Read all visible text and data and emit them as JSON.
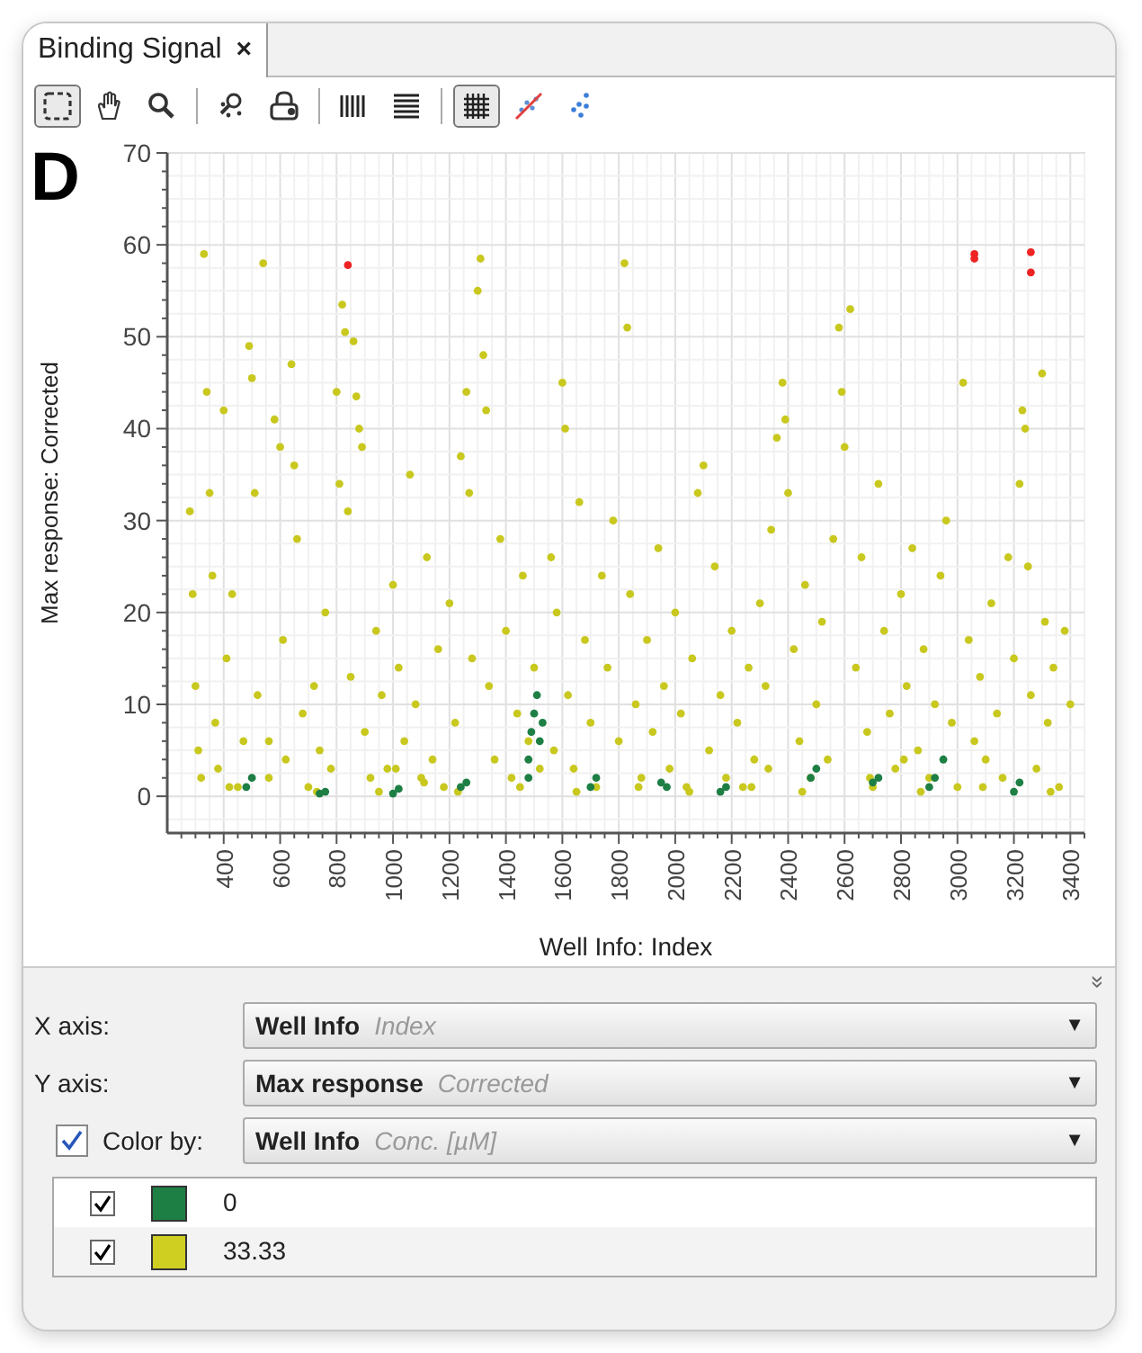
{
  "tabs": [
    {
      "label": "Binding Signal",
      "close": "×",
      "selected": true
    }
  ],
  "toolbar": [
    {
      "kind": "marquee",
      "selected": true
    },
    {
      "kind": "pan",
      "selected": false
    },
    {
      "kind": "zoom",
      "selected": false
    },
    {
      "kind": "separator"
    },
    {
      "kind": "mark",
      "selected": false
    },
    {
      "kind": "lock",
      "selected": false
    },
    {
      "kind": "separator"
    },
    {
      "kind": "columns",
      "selected": false
    },
    {
      "kind": "rows",
      "selected": false
    },
    {
      "kind": "separator"
    },
    {
      "kind": "grid",
      "selected": true
    },
    {
      "kind": "trend",
      "selected": false
    },
    {
      "kind": "scatter",
      "selected": false
    }
  ],
  "plot": {
    "panel_label": "D",
    "chart_data": {
      "type": "scatter",
      "xlabel": "Well Info: Index",
      "ylabel": "Max response: Corrected",
      "xlim": [
        200,
        3450
      ],
      "ylim": [
        -4,
        70
      ],
      "grid": true,
      "xticks": [
        400,
        600,
        800,
        1000,
        1200,
        1400,
        1600,
        1800,
        2000,
        2200,
        2400,
        2600,
        2800,
        3000,
        3200,
        3400
      ],
      "yticks": [
        0,
        10,
        20,
        30,
        40,
        50,
        60,
        70
      ],
      "series": [
        {
          "color": "#c9c81f",
          "x": [
            280,
            290,
            300,
            310,
            320,
            330,
            340,
            350,
            360,
            370,
            380,
            400,
            410,
            430,
            450,
            470,
            490,
            500,
            510,
            520,
            540,
            560,
            580,
            600,
            610,
            620,
            640,
            650,
            660,
            680,
            700,
            720,
            740,
            760,
            780,
            800,
            810,
            820,
            830,
            840,
            850,
            860,
            870,
            880,
            890,
            900,
            920,
            940,
            960,
            980,
            1000,
            1020,
            1040,
            1060,
            1080,
            1100,
            1120,
            1140,
            1160,
            1180,
            1200,
            1220,
            1240,
            1260,
            1270,
            1280,
            1300,
            1310,
            1320,
            1330,
            1340,
            1360,
            1380,
            1400,
            1420,
            1440,
            1460,
            1480,
            1500,
            1520,
            1560,
            1580,
            1600,
            1610,
            1620,
            1640,
            1660,
            1680,
            1700,
            1720,
            1740,
            1760,
            1780,
            1800,
            1820,
            1830,
            1840,
            1860,
            1880,
            1900,
            1920,
            1940,
            1960,
            1980,
            2000,
            2020,
            2040,
            2060,
            2080,
            2100,
            2120,
            2140,
            2160,
            2180,
            2200,
            2220,
            2240,
            2260,
            2280,
            2300,
            2320,
            2340,
            2360,
            2380,
            2390,
            2400,
            2420,
            2440,
            2460,
            2480,
            2500,
            2520,
            2540,
            2560,
            2580,
            2590,
            2600,
            2620,
            2640,
            2660,
            2680,
            2700,
            2720,
            2740,
            2760,
            2780,
            2800,
            2820,
            2840,
            2860,
            2880,
            2900,
            2920,
            2940,
            2960,
            2980,
            3000,
            3020,
            3040,
            3060,
            3080,
            3100,
            3120,
            3140,
            3160,
            3180,
            3200,
            3220,
            3230,
            3240,
            3250,
            3260,
            3280,
            3300,
            3310,
            3320,
            3340,
            3360,
            3380,
            3400,
            420,
            560,
            730,
            950,
            1110,
            1230,
            1450,
            1650,
            1870,
            2050,
            2270,
            2450,
            2690,
            2870,
            3090,
            3330,
            1010,
            1570,
            2330,
            2810
          ],
          "values": [
            31,
            22,
            12,
            5,
            2,
            59,
            44,
            33,
            24,
            8,
            3,
            42,
            15,
            22,
            1,
            6,
            49,
            45.5,
            33,
            11,
            58,
            2,
            41,
            38,
            17,
            4,
            47,
            36,
            28,
            9,
            1,
            12,
            5,
            20,
            3,
            44,
            34,
            53.5,
            50.5,
            31,
            13,
            49.5,
            43.5,
            40,
            38,
            7,
            2,
            18,
            11,
            3,
            23,
            14,
            6,
            35,
            10,
            2,
            26,
            4,
            16,
            1,
            21,
            8,
            37,
            44,
            33,
            15,
            55,
            58.5,
            48,
            42,
            12,
            4,
            28,
            18,
            2,
            9,
            24,
            6,
            14,
            3,
            26,
            20,
            45,
            40,
            11,
            3,
            32,
            17,
            8,
            1,
            24,
            14,
            30,
            6,
            58,
            51,
            22,
            10,
            2,
            17,
            7,
            27,
            12,
            3,
            20,
            9,
            1,
            15,
            33,
            36,
            5,
            25,
            11,
            2,
            18,
            8,
            1,
            14,
            4,
            21,
            12,
            29,
            39,
            45,
            41,
            33,
            16,
            6,
            23,
            2,
            10,
            19,
            4,
            28,
            51,
            44,
            38,
            53,
            14,
            26,
            7,
            1,
            34,
            18,
            9,
            3,
            22,
            12,
            27,
            5,
            16,
            2,
            10,
            24,
            30,
            8,
            1,
            45,
            17,
            6,
            13,
            4,
            21,
            9,
            2,
            26,
            15,
            34,
            42,
            40,
            25,
            11,
            3,
            46,
            19,
            8,
            14,
            1,
            18,
            10,
            1,
            6,
            0.5,
            0.5,
            1.5,
            0.5,
            1,
            0.5,
            1,
            0.5,
            1,
            0.5,
            2,
            0.5,
            1,
            0.5,
            3,
            5,
            3,
            4
          ]
        },
        {
          "color": "#1e7f45",
          "x": [
            480,
            500,
            740,
            760,
            1000,
            1020,
            1240,
            1260,
            1480,
            1490,
            1500,
            1510,
            1520,
            1480,
            1700,
            1720,
            1950,
            1970,
            2160,
            2180,
            2480,
            2500,
            2700,
            2720,
            2900,
            2920,
            3200,
            3220,
            2950,
            1530
          ],
          "values": [
            1,
            2,
            0.3,
            0.5,
            0.3,
            0.8,
            1,
            1.5,
            4,
            7,
            9,
            11,
            6,
            2,
            1,
            2,
            1.5,
            1,
            0.5,
            1,
            2,
            3,
            1.5,
            2,
            1,
            2,
            0.5,
            1.5,
            4,
            8
          ]
        },
        {
          "color": "#ee2424",
          "x": [
            840,
            3060,
            3060,
            3260,
            3260
          ],
          "values": [
            57.8,
            59,
            58.5,
            59.2,
            57
          ]
        }
      ]
    }
  },
  "collapse": "»",
  "settings": [
    {
      "label": "X axis:",
      "column": "Well Info",
      "detail": "Index",
      "caret": "▼"
    },
    {
      "label": "Y axis:",
      "column": "Max response",
      "detail": "Corrected",
      "caret": "▼"
    },
    {
      "label": "Color by:",
      "checked": true,
      "column": "Well Info",
      "detail": "Conc. [µM]",
      "caret": "▼"
    }
  ],
  "legend": [
    {
      "checked": true,
      "color": "#1e7f45",
      "label": "0"
    },
    {
      "checked": true,
      "color": "#cfcf22",
      "label": "33.33"
    }
  ]
}
